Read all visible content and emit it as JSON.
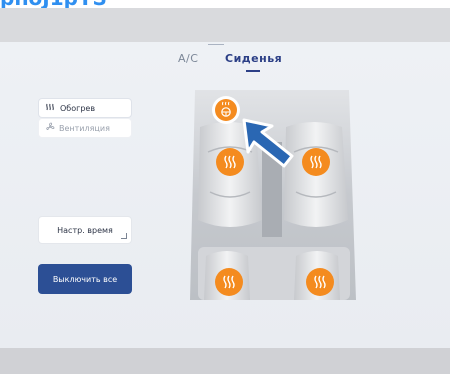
{
  "caption": "pnoJ1pYS",
  "tabs": [
    {
      "label": "A/C",
      "active": false
    },
    {
      "label": "Сиденья",
      "active": true
    }
  ],
  "buttons": {
    "heat": {
      "icon": "heat-icon",
      "label": "Обогрев"
    },
    "vent": {
      "icon": "fan-icon",
      "label": "Вентиляция"
    },
    "timer": {
      "label": "Настр. время"
    },
    "off_all": {
      "label": "Выключить все"
    }
  },
  "seats": [
    {
      "position": "steering",
      "icon": "steering-heat-icon",
      "active": true
    },
    {
      "position": "front-left",
      "icon": "heat-icon",
      "active": true
    },
    {
      "position": "front-right",
      "icon": "heat-icon",
      "active": true
    },
    {
      "position": "rear-left",
      "icon": "heat-icon",
      "active": true
    },
    {
      "position": "rear-right",
      "icon": "heat-icon",
      "active": true
    }
  ],
  "colors": {
    "accent": "#2c4f95",
    "heat_button": "#f48b1f",
    "arrow": "#2a67b3",
    "caption": "#2f8ff0"
  }
}
